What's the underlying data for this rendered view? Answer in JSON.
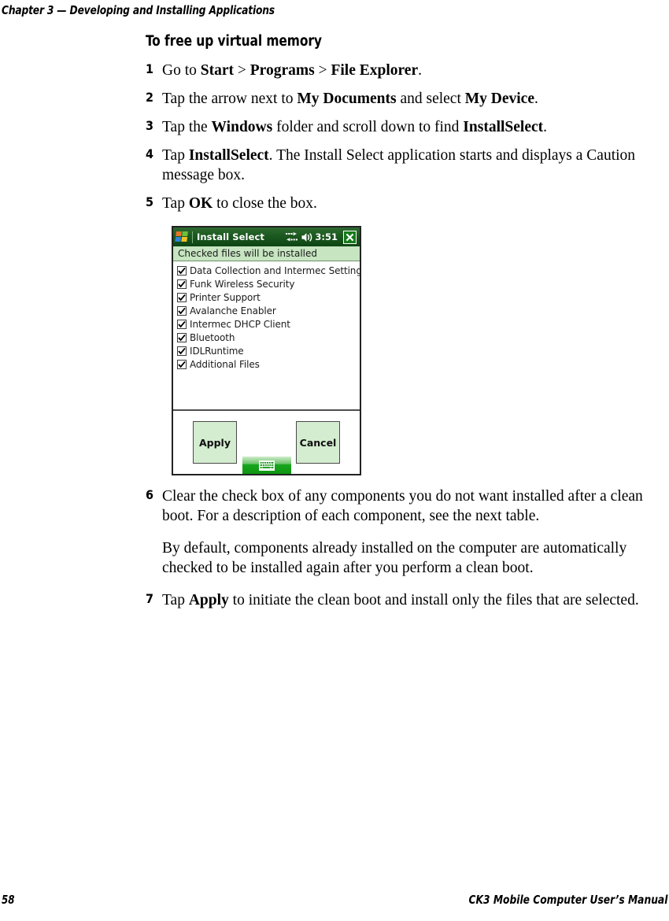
{
  "page": {
    "running_head": "Chapter 3 — Developing and Installing Applications",
    "folio": "58",
    "manual_title": "CK3 Mobile Computer User’s Manual"
  },
  "section": {
    "heading": "To free up virtual memory"
  },
  "steps": [
    {
      "num": "1",
      "text_html": "Go to <b>Start</b> &gt; <b>Programs</b> &gt; <b>File Explorer</b>."
    },
    {
      "num": "2",
      "text_html": "Tap the arrow next to <b>My Documents</b> and select <b>My Device</b>."
    },
    {
      "num": "3",
      "text_html": "Tap the <b>Windows</b> folder and scroll down to find <b>InstallSelect</b>."
    },
    {
      "num": "4",
      "text_html": "Tap <b>InstallSelect</b>. The Install Select application starts and displays a Caution message box."
    },
    {
      "num": "5",
      "text_html": "Tap <b>OK</b> to close the box."
    }
  ],
  "steps_after": [
    {
      "num": "6",
      "text_html": "Clear the check box of any components you do not want installed after a clean boot. For a description of each component, see the next table."
    },
    {
      "num": "7",
      "text_html": "Tap <b>Apply</b> to initiate the clean boot and install only the files that are selected."
    }
  ],
  "note": "By default, components already installed on the computer are automatically checked to be installed again after you perform a clean boot.",
  "figure": {
    "titlebar": {
      "app_title": "Install Select",
      "time": "3:51",
      "icons": [
        "windows-flag-icon",
        "connectivity-icon",
        "speaker-icon",
        "close-icon"
      ]
    },
    "banner": "Checked files will be installed",
    "items": [
      {
        "label": "Data Collection and Intermec Settings",
        "checked": true
      },
      {
        "label": "Funk Wireless Security",
        "checked": true
      },
      {
        "label": "Printer Support",
        "checked": true
      },
      {
        "label": "Avalanche Enabler",
        "checked": true
      },
      {
        "label": "Intermec DHCP Client",
        "checked": true
      },
      {
        "label": "Bluetooth",
        "checked": true
      },
      {
        "label": "IDLRuntime",
        "checked": true
      },
      {
        "label": "Additional Files",
        "checked": true
      }
    ],
    "buttons": {
      "apply": "Apply",
      "cancel": "Cancel"
    },
    "taskbar": {
      "sip_icon": "keyboard-icon"
    },
    "colors": {
      "titlebar_green": "#1d5a21",
      "banner_green": "#c6e5c0",
      "button_green": "#d4ecd0",
      "sip_green": "#18a61e"
    }
  }
}
